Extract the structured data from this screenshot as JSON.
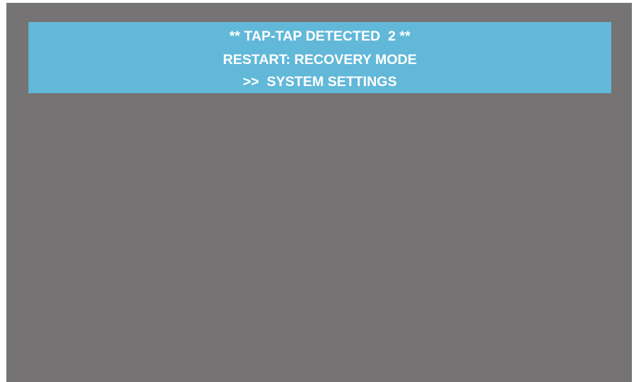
{
  "colors": {
    "screen_background": "#767374",
    "banner_background": "#62b8d8",
    "banner_text": "#ffffff"
  },
  "banner": {
    "line1": "** TAP-TAP DETECTED  2 **",
    "line2": "RESTART: RECOVERY MODE",
    "line3": ">>  SYSTEM SETTINGS"
  }
}
